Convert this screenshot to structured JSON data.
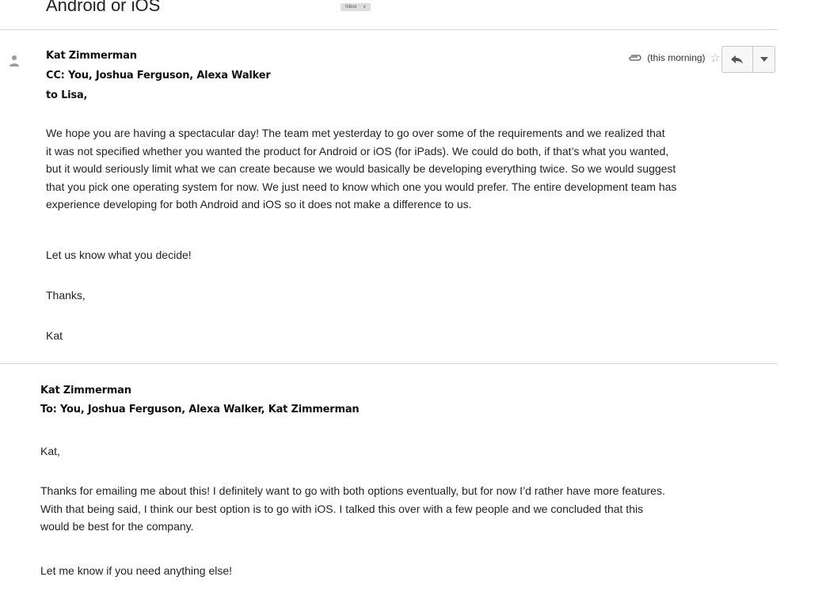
{
  "thread": {
    "subject": "Android or iOS",
    "label": "Inbox",
    "label_close": "x"
  },
  "message1": {
    "sender": "Kat Zimmerman",
    "cc": "CC: You, Joshua Ferguson, Alexa Walker",
    "to": "to Lisa,",
    "time": "(this morning)",
    "icons": {
      "attachment": "paperclip-icon",
      "star": "star-icon",
      "reply": "reply-icon",
      "more": "dropdown-arrow-icon",
      "avatar": "person-icon"
    },
    "paragraph1_lines": [
      "We hope you are having a spectacular day! The team met yesterday to go over some of the requirements and we realized that",
      "it was not specified whether you wanted the product for Android or iOS (for iPads). We could do both, if that’s what you wanted,",
      "but it would seriously limit what we can create because we would basically be developing everything twice. So we would suggest",
      "that you pick one operating system for now. We just need to know which one you would prefer. The entire development team has",
      "experience developing for both Android and iOS so it does not make a difference to us."
    ],
    "paragraph2": "Let us know what you decide!",
    "closing": "Thanks,",
    "signature": "Kat"
  },
  "message2": {
    "sender": "Kat Zimmerman",
    "to": "To: You, Joshua Ferguson, Alexa Walker, Kat Zimmerman",
    "greeting": "Kat,",
    "paragraph1_lines": [
      "Thanks for emailing me about this! I definitely want to go with both options eventually, but for now I’d rather have more features.",
      "With that being said, I think our best option is to go with iOS. I talked this over with a few people and we concluded that this",
      "would be best for the company."
    ],
    "paragraph2": "Let me know if you need anything else!"
  }
}
